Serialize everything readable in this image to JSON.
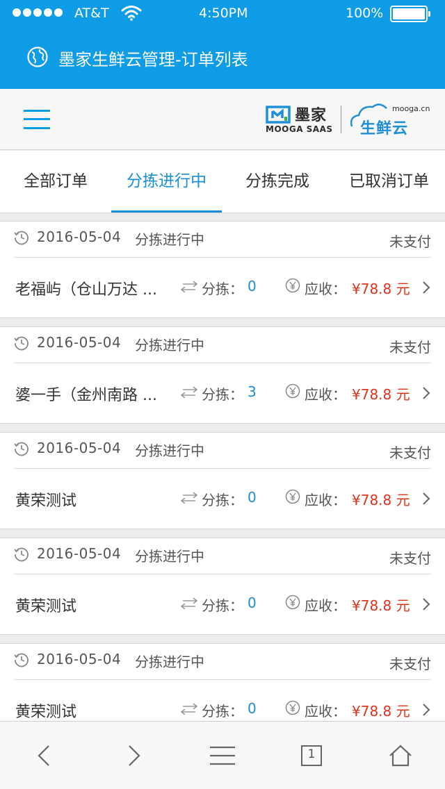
{
  "status_bar": {
    "carrier": "AT&T",
    "time": "4:50PM",
    "battery": "100%"
  },
  "header": {
    "title": "墨家生鲜云管理-订单列表"
  },
  "brand": {
    "mooga_cn": "墨家",
    "mooga_en": "MOOGA SAAS",
    "cloud_site": "mooga.cn",
    "cloud_name": "生鲜云"
  },
  "tabs": [
    {
      "label": "全部订单",
      "active": false
    },
    {
      "label": "分拣进行中",
      "active": true
    },
    {
      "label": "分拣完成",
      "active": false
    },
    {
      "label": "已取消订单",
      "active": false
    }
  ],
  "orders": [
    {
      "date": "2016-05-04",
      "state": "分拣进行中",
      "pay_status": "未支付",
      "shop": "老福屿（仓山万达 ...",
      "sort_label": "分拣：",
      "sort_count": "0",
      "due_label": "应收：",
      "amount": "¥78.8 元"
    },
    {
      "date": "2016-05-04",
      "state": "分拣进行中",
      "pay_status": "未支付",
      "shop": "婆一手（金州南路 ...",
      "sort_label": "分拣：",
      "sort_count": "3",
      "due_label": "应收：",
      "amount": "¥78.8 元"
    },
    {
      "date": "2016-05-04",
      "state": "分拣进行中",
      "pay_status": "未支付",
      "shop": "黄荣测试",
      "sort_label": "分拣：",
      "sort_count": "0",
      "due_label": "应收：",
      "amount": "¥78.8 元"
    },
    {
      "date": "2016-05-04",
      "state": "分拣进行中",
      "pay_status": "未支付",
      "shop": "黄荣测试",
      "sort_label": "分拣：",
      "sort_count": "0",
      "due_label": "应收：",
      "amount": "¥78.8 元"
    },
    {
      "date": "2016-05-04",
      "state": "分拣进行中",
      "pay_status": "未支付",
      "shop": "黄荣测试",
      "sort_label": "分拣：",
      "sort_count": "0",
      "due_label": "应收：",
      "amount": "¥78.8 元"
    }
  ],
  "toolbar": {
    "tab_count": "1",
    "icons": [
      "back-icon",
      "forward-icon",
      "menu-icon",
      "tabs-icon",
      "home-icon"
    ]
  },
  "colors": {
    "accent": "#0d9ce5",
    "tab_active": "#1a8fd8",
    "amount": "#e0331b"
  }
}
